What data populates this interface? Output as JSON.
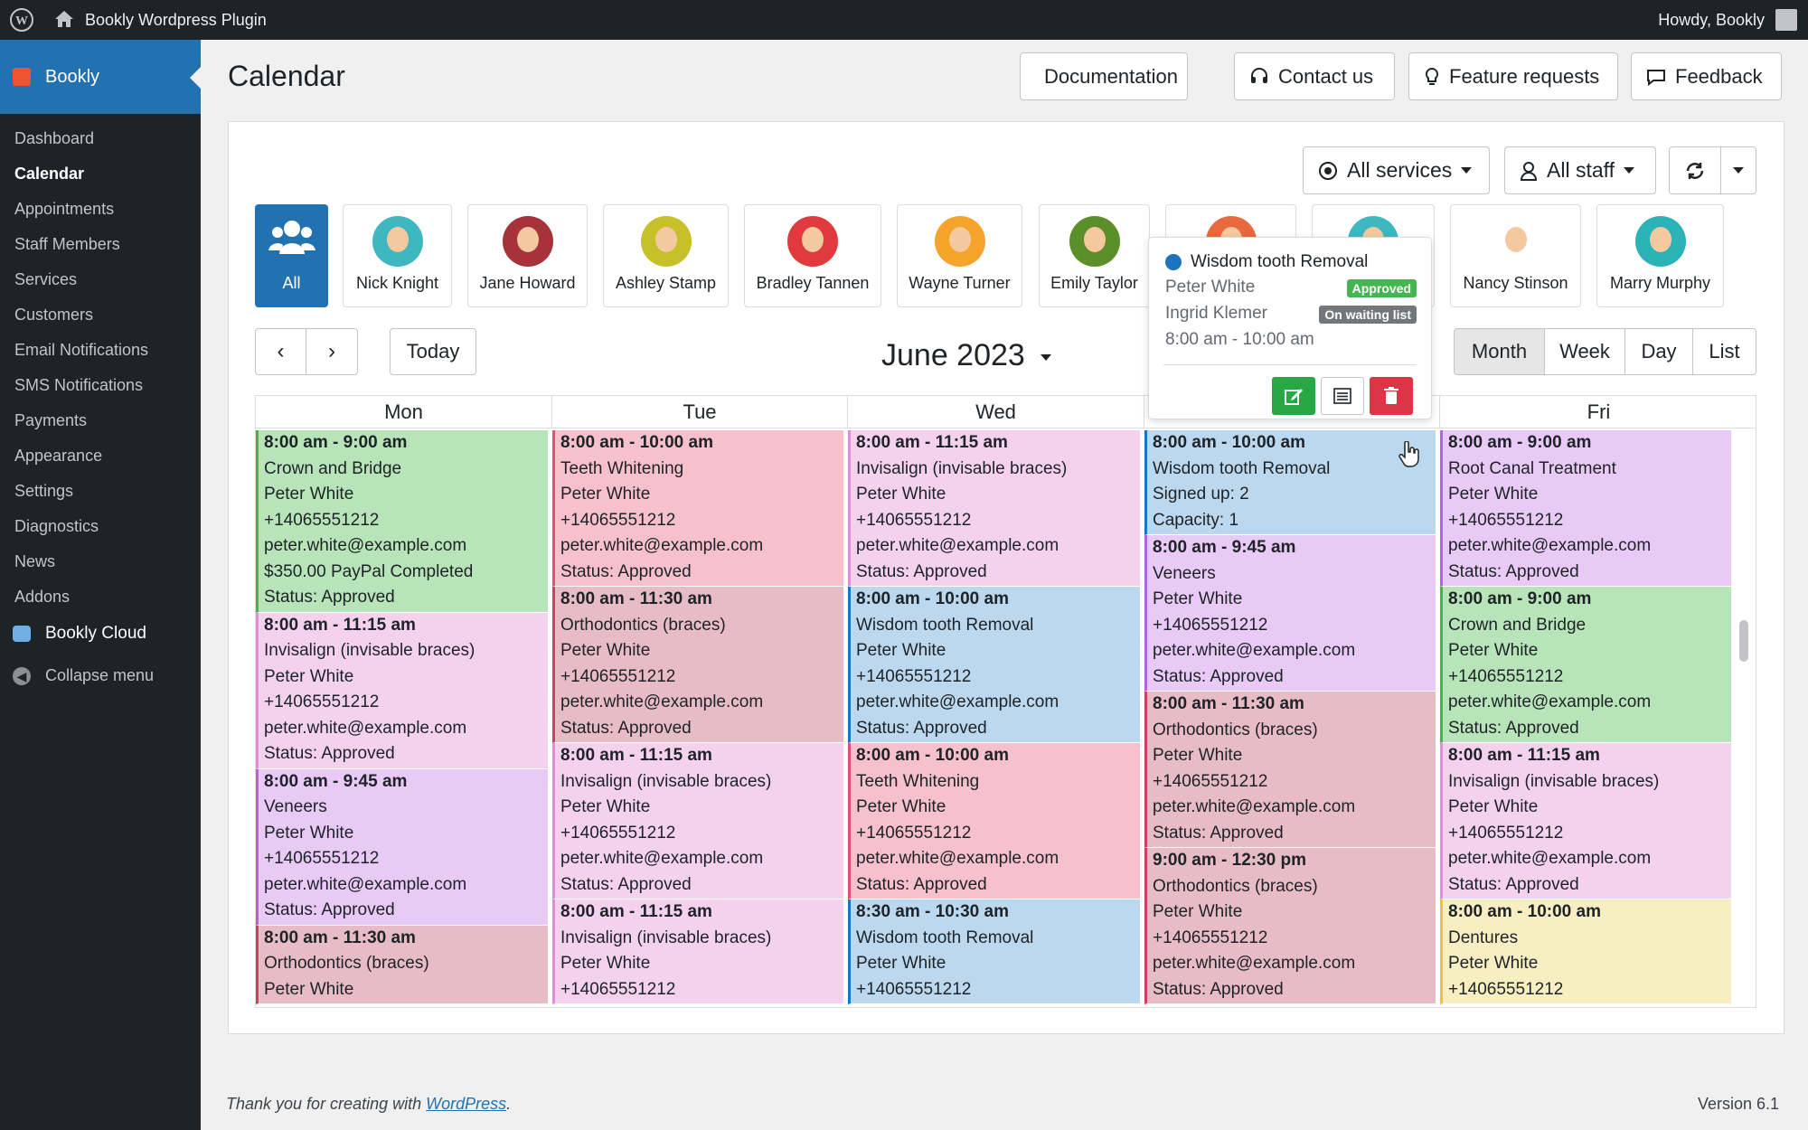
{
  "adminbar": {
    "site_name": "Bookly Wordpress Plugin",
    "howdy": "Howdy, Bookly"
  },
  "sidebar": {
    "plugin_title": "Bookly",
    "items": [
      "Dashboard",
      "Calendar",
      "Appointments",
      "Staff Members",
      "Services",
      "Customers",
      "Email Notifications",
      "SMS Notifications",
      "Payments",
      "Appearance",
      "Settings",
      "Diagnostics",
      "News",
      "Addons"
    ],
    "current": "Calendar",
    "cloud": "Bookly Cloud",
    "collapse": "Collapse menu"
  },
  "header": {
    "title": "Calendar",
    "buttons": {
      "documentation": "Documentation",
      "contact": "Contact us",
      "features": "Feature requests",
      "feedback": "Feedback"
    }
  },
  "filters": {
    "services": "All services",
    "staff": "All staff"
  },
  "staff": [
    {
      "name": "All"
    },
    {
      "name": "Nick Knight",
      "color": "#3fb7c1"
    },
    {
      "name": "Jane Howard",
      "color": "#a8323a"
    },
    {
      "name": "Ashley Stamp",
      "color": "#c6c02a"
    },
    {
      "name": "Bradley Tannen",
      "color": "#e0393e"
    },
    {
      "name": "Wayne Turner",
      "color": "#f6a32b"
    },
    {
      "name": "Emily Taylor",
      "color": "#5b8f2a"
    },
    {
      "name": "",
      "color": "#e86a3c"
    },
    {
      "name": "",
      "color": "#3fb7c1"
    },
    {
      "name": "Nancy Stinson",
      "color": "#ffffff"
    },
    {
      "name": "Marry Murphy",
      "color": "#2bb3b8"
    }
  ],
  "nav": {
    "prev": "‹",
    "next": "›",
    "today": "Today",
    "month_title": "June 2023"
  },
  "views": {
    "month": "Month",
    "week": "Week",
    "day": "Day",
    "list": "List"
  },
  "days": [
    "Mon",
    "Tue",
    "Wed",
    "",
    "Fri"
  ],
  "popover": {
    "title": "Wisdom tooth Removal",
    "customer1": "Peter White",
    "status1": "Approved",
    "customer2": "Ingrid Klemer",
    "status2": "On waiting list",
    "time": "8:00 am - 10:00 am"
  },
  "columns": [
    {
      "events": [
        {
          "lines": [
            "8:00 am - 9:00 am",
            "Crown and Bridge",
            "Peter White",
            "+14065551212",
            "peter.white@example.com",
            "$350.00 PayPal Completed",
            "Status: Approved"
          ],
          "bg": "#b8e4b9",
          "border": "#4caf50"
        },
        {
          "lines": [
            "8:00 am - 11:15 am",
            "Invisalign (invisable braces)",
            "Peter White",
            "+14065551212",
            "peter.white@example.com",
            "Status: Approved"
          ],
          "bg": "#f4d2ee",
          "border": "#e08fd6"
        },
        {
          "lines": [
            "8:00 am - 9:45 am",
            "Veneers",
            "Peter White",
            "+14065551212",
            "peter.white@example.com",
            "Status: Approved"
          ],
          "bg": "#e9c9f6",
          "border": "#b066d6"
        },
        {
          "lines": [
            "8:00 am - 11:30 am",
            "Orthodontics (braces)",
            "Peter White"
          ],
          "bg": "#e8bcc6",
          "border": "#c9425f"
        }
      ]
    },
    {
      "events": [
        {
          "lines": [
            "8:00 am - 10:00 am",
            "Teeth Whitening",
            "Peter White",
            "+14065551212",
            "peter.white@example.com",
            "Status: Approved"
          ],
          "bg": "#f6c1cc",
          "border": "#e25073"
        },
        {
          "lines": [
            "8:00 am - 11:30 am",
            "Orthodontics (braces)",
            "Peter White",
            "+14065551212",
            "peter.white@example.com",
            "Status: Approved"
          ],
          "bg": "#e8bcc6",
          "border": "#c9425f"
        },
        {
          "lines": [
            "8:00 am - 11:15 am",
            "Invisalign (invisable braces)",
            "Peter White",
            "+14065551212",
            "peter.white@example.com",
            "Status: Approved"
          ],
          "bg": "#f4d2ee",
          "border": "#e08fd6"
        },
        {
          "lines": [
            "8:00 am - 11:15 am",
            "Invisalign (invisable braces)",
            "Peter White",
            "+14065551212"
          ],
          "bg": "#f4d2ee",
          "border": "#e08fd6"
        }
      ]
    },
    {
      "events": [
        {
          "lines": [
            "8:00 am - 11:15 am",
            "Invisalign (invisable braces)",
            "Peter White",
            "+14065551212",
            "peter.white@example.com",
            "Status: Approved"
          ],
          "bg": "#f4d2ee",
          "border": "#e08fd6"
        },
        {
          "lines": [
            "8:00 am - 10:00 am",
            "Wisdom tooth Removal",
            "Peter White",
            "+14065551212",
            "peter.white@example.com",
            "Status: Approved"
          ],
          "bg": "#bcd8ef",
          "border": "#1e73be"
        },
        {
          "lines": [
            "8:00 am - 10:00 am",
            "Teeth Whitening",
            "Peter White",
            "+14065551212",
            "peter.white@example.com",
            "Status: Approved"
          ],
          "bg": "#f6c1cc",
          "border": "#e25073"
        },
        {
          "lines": [
            "8:30 am - 10:30 am",
            "Wisdom tooth Removal",
            "Peter White",
            "+14065551212"
          ],
          "bg": "#bcd8ef",
          "border": "#1e73be"
        }
      ]
    },
    {
      "events": [
        {
          "lines": [
            "8:00 am - 10:00 am",
            "Wisdom tooth Removal",
            "Signed up: 2",
            "Capacity: 1"
          ],
          "bg": "#bcd8ef",
          "border": "#1e73be"
        },
        {
          "lines": [
            "8:00 am - 9:45 am",
            "Veneers",
            "Peter White",
            "+14065551212",
            "peter.white@example.com",
            "Status: Approved"
          ],
          "bg": "#e9c9f6",
          "border": "#b066d6"
        },
        {
          "lines": [
            "8:00 am - 11:30 am",
            "Orthodontics (braces)",
            "Peter White",
            "+14065551212",
            "peter.white@example.com",
            "Status: Approved"
          ],
          "bg": "#e8bcc6",
          "border": "#c9425f"
        },
        {
          "lines": [
            "9:00 am - 12:30 pm",
            "Orthodontics (braces)",
            "Peter White",
            "+14065551212",
            "peter.white@example.com",
            "Status: Approved"
          ],
          "bg": "#e8bcc6",
          "border": "#c9425f"
        }
      ]
    },
    {
      "events": [
        {
          "lines": [
            "8:00 am - 9:00 am",
            "Root Canal Treatment",
            "Peter White",
            "+14065551212",
            "peter.white@example.com",
            "Status: Approved"
          ],
          "bg": "#e9c9f6",
          "border": "#b066d6"
        },
        {
          "lines": [
            "8:00 am - 9:00 am",
            "Crown and Bridge",
            "Peter White",
            "+14065551212",
            "peter.white@example.com",
            "Status: Approved"
          ],
          "bg": "#b8e4b9",
          "border": "#4caf50"
        },
        {
          "lines": [
            "8:00 am - 11:15 am",
            "Invisalign (invisable braces)",
            "Peter White",
            "+14065551212",
            "peter.white@example.com",
            "Status: Approved"
          ],
          "bg": "#f4d2ee",
          "border": "#e08fd6"
        },
        {
          "lines": [
            "8:00 am - 10:00 am",
            "Dentures",
            "Peter White",
            "+14065551212"
          ],
          "bg": "#f7eec2",
          "border": "#e7c544"
        }
      ]
    }
  ],
  "footer": {
    "thanks": "Thank you for creating with ",
    "wp_link": "WordPress",
    "period": ".",
    "version": "Version 6.1"
  }
}
